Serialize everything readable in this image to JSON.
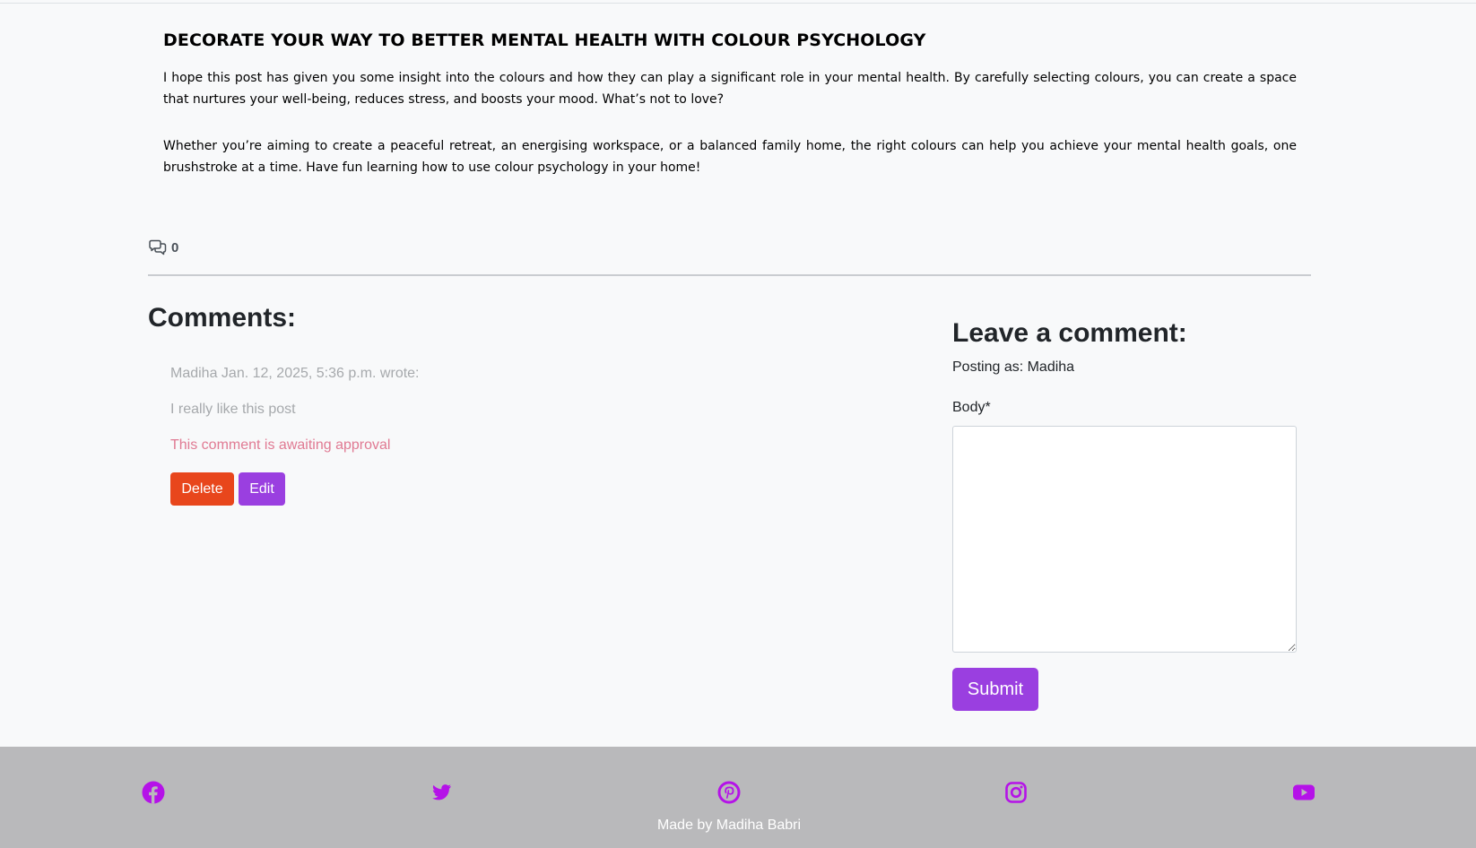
{
  "post": {
    "heading": "DECORATE YOUR WAY TO BETTER MENTAL HEALTH WITH COLOUR PSYCHOLOGY",
    "paragraph_1": "I hope this post has given you some insight into the colours and how they can play a significant role in your mental health. By carefully selecting colours, you can create a space that nurtures your well-being, reduces stress, and boosts your mood. What’s not to love?",
    "paragraph_2": "Whether you’re aiming to create a peaceful retreat, an energising workspace, or a balanced family home, the right colours can help you achieve your mental health goals, one brushstroke at a time. Have fun learning how to use colour psychology in your home!"
  },
  "comment_count": {
    "icon": "comments-icon",
    "value": "0"
  },
  "comments": {
    "title": "Comments:",
    "items": [
      {
        "meta": "Madiha Jan. 12, 2025, 5:36 p.m. wrote:",
        "body": "I really like this post",
        "status": "This comment is awaiting approval",
        "delete_label": "Delete",
        "edit_label": "Edit"
      }
    ]
  },
  "comment_form": {
    "title": "Leave a comment:",
    "posting_as": "Posting as: Madiha",
    "body_label": "Body*",
    "body_value": "",
    "submit_label": "Submit"
  },
  "footer": {
    "social_icons": [
      "facebook-icon",
      "twitter-icon",
      "pinterest-icon",
      "instagram-icon",
      "youtube-icon"
    ],
    "made_by": "Made by Madiha Babri"
  },
  "colors": {
    "page_background": "#f8f9fa",
    "delete_button": "#e8461c",
    "accent_purple": "#9a3fe0",
    "social_icon": "#b512e8",
    "footer_background": "#b9b9bb",
    "awaiting_approval": "#e07a93"
  }
}
